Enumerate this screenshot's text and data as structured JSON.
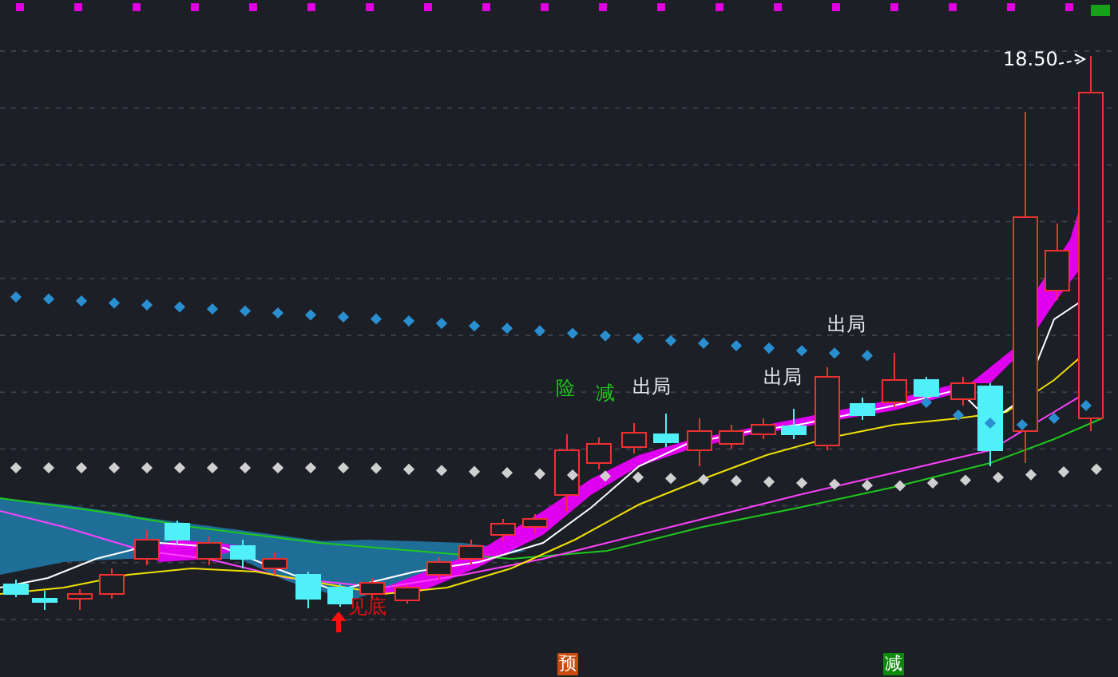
{
  "chart": {
    "price_label": "18.50",
    "markers": [
      {
        "text": "险",
        "color": "#1ec81e"
      },
      {
        "text": "减",
        "color": "#1ec81e"
      },
      {
        "text": "出局",
        "color": "#e8ecf2"
      },
      {
        "text": "出局",
        "color": "#e8ecf2"
      },
      {
        "text": "出局",
        "color": "#e8ecf2"
      },
      {
        "text": "见底",
        "color": "#e01010"
      }
    ],
    "badges": [
      {
        "text": "预",
        "color": "#c84a0c"
      },
      {
        "text": "减",
        "color": "#0c8a0c"
      }
    ]
  }
}
